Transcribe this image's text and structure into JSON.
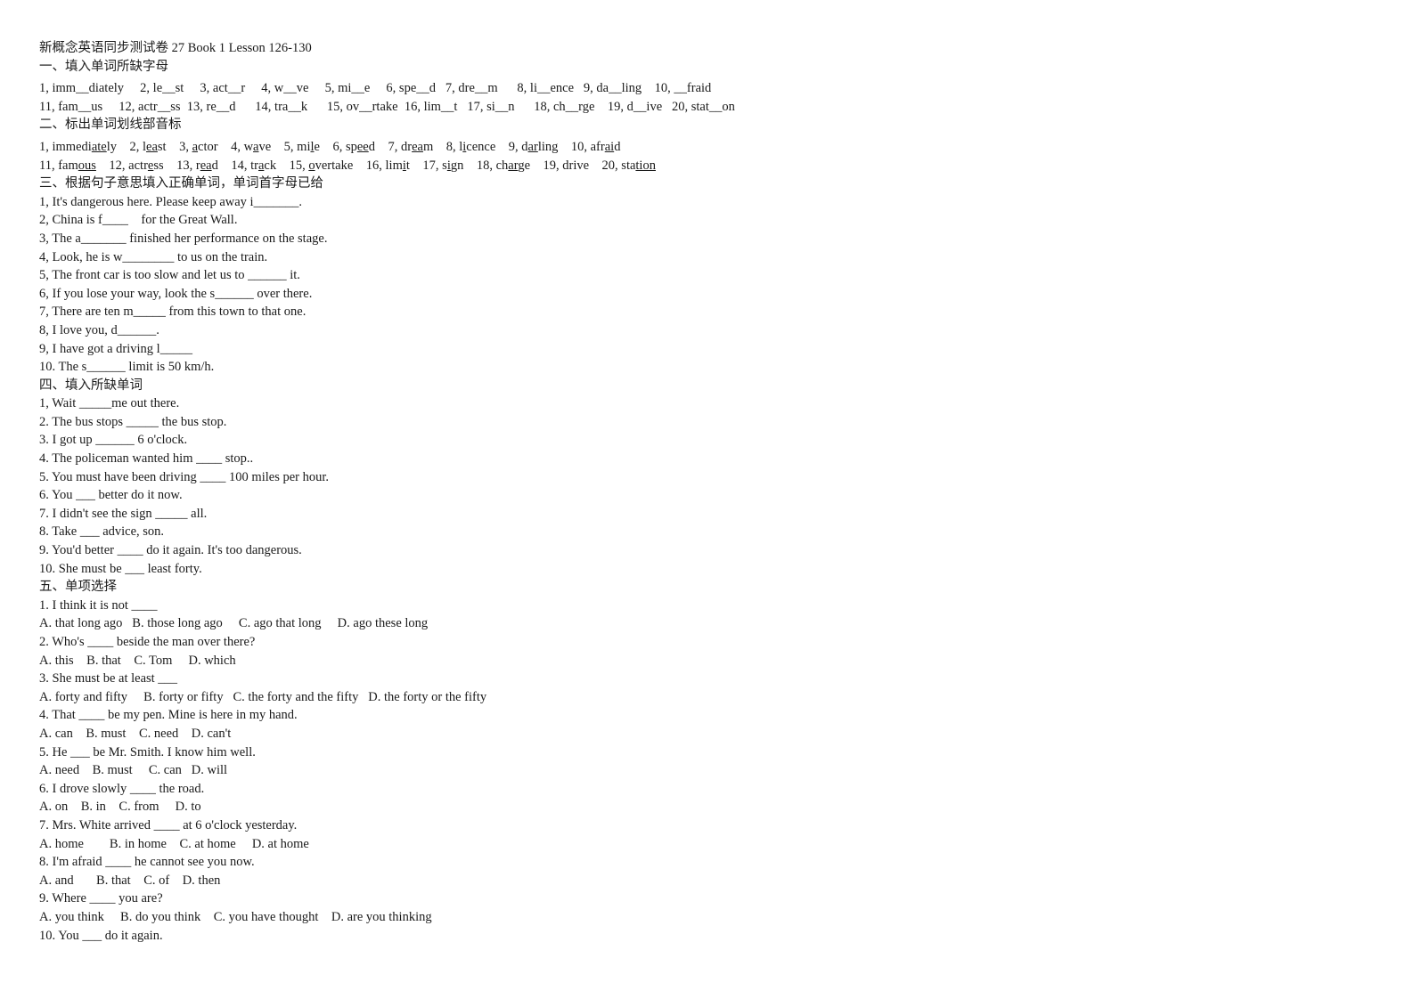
{
  "document": {
    "title": "新概念英语同步测试卷 27 Book 1 Lesson 126-130"
  },
  "section1": {
    "heading": "一、填入单词所缺字母",
    "lines": [
      "1, imm__diately     2, le__st     3, act__r     4, w__ve     5, mi__e     6, spe__d   7, dre__m      8, li__ence   9, da__ling    10, __fraid",
      "11, fam__us     12, actr__ss  13, re__d      14, tra__k      15, ov__rtake  16, lim__t   17, si__n      18, ch__rge    19, d__ive   20, stat__on"
    ]
  },
  "section2": {
    "heading": "二、标出单词划线部音标",
    "items_line1": [
      {
        "num": "1,",
        "pre": "immedi",
        "mark": "ate",
        "post": "ly"
      },
      {
        "num": "2,",
        "pre": "l",
        "mark": "ea",
        "post": "st"
      },
      {
        "num": "3,",
        "pre": "",
        "mark": "a",
        "post": "ctor"
      },
      {
        "num": "4,",
        "pre": "w",
        "mark": "a",
        "post": "ve"
      },
      {
        "num": "5,",
        "pre": "mi",
        "mark": "l",
        "post": "e"
      },
      {
        "num": "6,",
        "pre": "sp",
        "mark": "ee",
        "post": "d"
      },
      {
        "num": "7,",
        "pre": "dr",
        "mark": "ea",
        "post": "m"
      },
      {
        "num": "8,",
        "pre": "l",
        "mark": "i",
        "post": "cence"
      },
      {
        "num": "9,",
        "pre": "d",
        "mark": "ar",
        "post": "ling"
      },
      {
        "num": "10,",
        "pre": "afr",
        "mark": "ai",
        "post": "d"
      }
    ],
    "items_line2": [
      {
        "num": "11,",
        "pre": "fam",
        "mark": "ous",
        "post": ""
      },
      {
        "num": "12,",
        "pre": "actr",
        "mark": "e",
        "post": "ss"
      },
      {
        "num": "13,",
        "pre": "r",
        "mark": "ea",
        "post": "d"
      },
      {
        "num": "14,",
        "pre": "tr",
        "mark": "a",
        "post": "ck"
      },
      {
        "num": "15,",
        "pre": "",
        "mark": "o",
        "post": "vertake"
      },
      {
        "num": "16,",
        "pre": "lim",
        "mark": "i",
        "post": "t"
      },
      {
        "num": "17,",
        "pre": "s",
        "mark": "i",
        "post": "gn"
      },
      {
        "num": "18,",
        "pre": "ch",
        "mark": "ar",
        "post": "ge"
      },
      {
        "num": "19,",
        "pre": "drive",
        "mark": "",
        "post": ""
      },
      {
        "num": "20,",
        "pre": "sta",
        "mark": "tion",
        "post": ""
      }
    ]
  },
  "section3": {
    "heading": "三、根据句子意思填入正确单词，单词首字母已给",
    "lines": [
      "1, It's dangerous here. Please keep away i_______.",
      "2, China is f____    for the Great Wall.",
      "3, The a_______ finished her performance on the stage.",
      "4, Look, he is w________ to us on the train.",
      "5, The front car is too slow and let us to ______ it.",
      "6, If you lose your way, look the s______ over there.",
      "7, There are ten m_____ from this town to that one.",
      "8, I love you, d______.",
      "9, I have got a driving l_____",
      "10. The s______ limit is 50 km/h."
    ]
  },
  "section4": {
    "heading": "四、填入所缺单词",
    "lines": [
      "1, Wait _____me out there.",
      "2. The bus stops _____ the bus stop.",
      "3. I got up ______ 6 o'clock.",
      "4. The policeman wanted him ____ stop..",
      "5. You must have been driving ____ 100 miles per hour.",
      "6. You ___ better do it now.",
      "7. I didn't see the sign _____ all.",
      "8. Take ___ advice, son.",
      "9. You'd better ____ do it again. It's too dangerous.",
      "10. She must be ___ least forty."
    ]
  },
  "section5": {
    "heading": "五、单项选择",
    "questions": [
      {
        "stem": "1. I think it is not ____",
        "options": "A. that long ago   B. those long ago     C. ago that long     D. ago these long"
      },
      {
        "stem": "2. Who's ____ beside the man over there?",
        "options": "A. this    B. that    C. Tom     D. which"
      },
      {
        "stem": "3. She must be at least ___",
        "options": "A. forty and fifty     B. forty or fifty   C. the forty and the fifty   D. the forty or the fifty"
      },
      {
        "stem": "4. That ____ be my pen. Mine is here in my hand.",
        "options": "A. can    B. must    C. need    D. can't"
      },
      {
        "stem": "5. He ___ be Mr. Smith. I know him well.",
        "options": "A. need    B. must     C. can   D. will"
      },
      {
        "stem": "6. I drove slowly ____ the road.",
        "options": "A. on    B. in    C. from     D. to"
      },
      {
        "stem": "7. Mrs. White arrived ____ at 6 o'clock yesterday.",
        "options": "A. home        B. in home    C. at home     D. at home"
      },
      {
        "stem": "8. I'm afraid ____ he cannot see you now.",
        "options": "A. and       B. that    C. of    D. then"
      },
      {
        "stem": "9. Where ____ you are?",
        "options": "A. you think     B. do you think    C. you have thought    D. are you thinking"
      },
      {
        "stem": "10. You ___ do it again.",
        "options": ""
      }
    ]
  }
}
